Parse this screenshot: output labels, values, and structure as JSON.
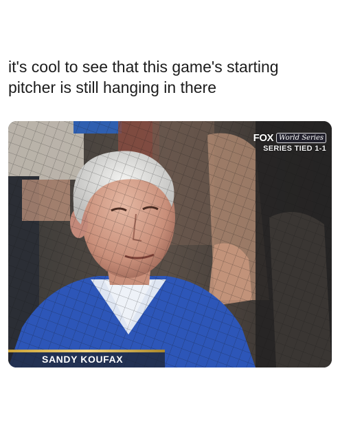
{
  "post": {
    "caption_line1": "it's cool to see that this game's starting",
    "caption_line2": "pitcher is still hanging in there"
  },
  "broadcast": {
    "network": "FOX",
    "event_logo": "World Series",
    "series_status": "SERIES TIED 1-1",
    "lower_third_name": "SANDY KOUFAX",
    "accent_color": "#d9b34f"
  }
}
